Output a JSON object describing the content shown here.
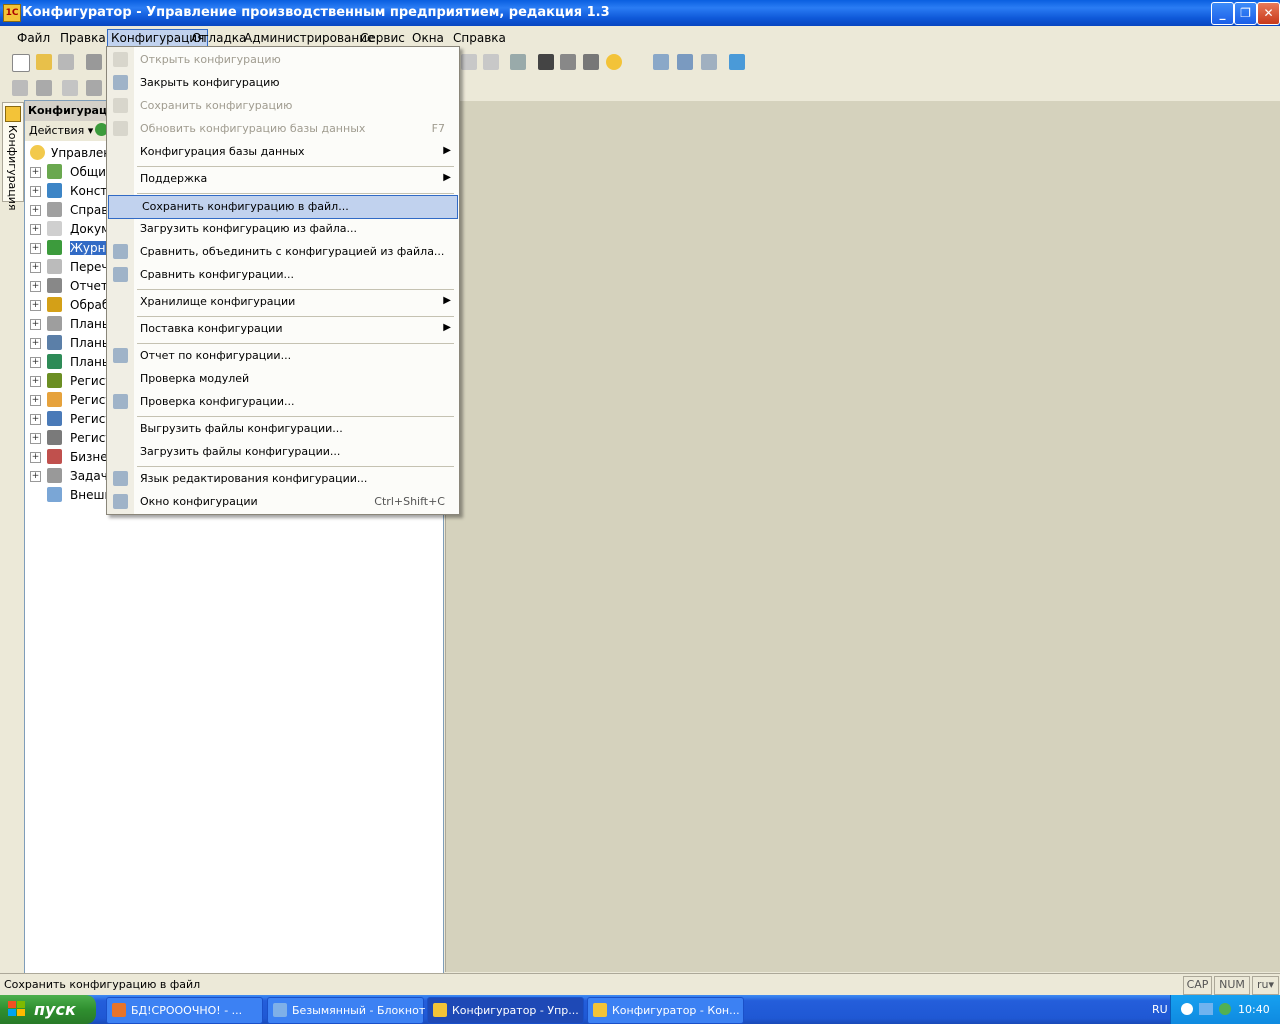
{
  "window": {
    "title": "Конфигуратор - Управление производственным предприятием, редакция 1.3",
    "min_label": "_",
    "max_label": "❐",
    "close_label": "✕"
  },
  "menubar": [
    "Файл",
    "Правка",
    "Конфигурация",
    "Отладка",
    "Администрирование",
    "Сервис",
    "Окна",
    "Справка"
  ],
  "side_tab_label": "Конфигурация",
  "panel": {
    "title": "Конфигураци",
    "actions_label": "Действия ▾",
    "tree": [
      {
        "label": "Управлени",
        "root": true,
        "icon_color": "#f2c94c"
      },
      {
        "label": "Общие",
        "icon_color": "#6aa84f"
      },
      {
        "label": "Конста",
        "icon_color": "#3d85c6"
      },
      {
        "label": "Справо",
        "icon_color": "#a0a0a0"
      },
      {
        "label": "Докум",
        "icon_color": "#cfcfcf"
      },
      {
        "label": "Журна",
        "selected": true,
        "icon_color": "#3c9b3c"
      },
      {
        "label": "Перечи",
        "icon_color": "#bbbbbb"
      },
      {
        "label": "Отчеты",
        "icon_color": "#888888"
      },
      {
        "label": "Обрабо",
        "icon_color": "#d4a017"
      },
      {
        "label": "Планы",
        "icon_color": "#9e9e9e"
      },
      {
        "label": "Планы",
        "icon_color": "#5b7fa8"
      },
      {
        "label": "Планы",
        "icon_color": "#2e8b57"
      },
      {
        "label": "Регист",
        "icon_color": "#6b8e23"
      },
      {
        "label": "Регист",
        "icon_color": "#e6a23c"
      },
      {
        "label": "Регист",
        "icon_color": "#4a7ab8"
      },
      {
        "label": "Регист",
        "icon_color": "#7a7a7a"
      },
      {
        "label": "Бизнес",
        "icon_color": "#c0504d"
      },
      {
        "label": "Задачи",
        "icon_color": "#999999"
      },
      {
        "label": "Внешни",
        "noexpand": true,
        "icon_color": "#7aa6d6"
      }
    ]
  },
  "dropdown": [
    {
      "label": "Открыть конфигурацию",
      "disabled": true,
      "icon": true
    },
    {
      "label": "Закрыть конфигурацию",
      "icon": true
    },
    {
      "label": "Сохранить конфигурацию",
      "disabled": true,
      "icon": true
    },
    {
      "label": "Обновить конфигурацию базы данных",
      "disabled": true,
      "shortcut": "F7",
      "icon": true
    },
    {
      "label": "Конфигурация базы данных",
      "submenu": true
    },
    {
      "sep": true
    },
    {
      "label": "Поддержка",
      "submenu": true
    },
    {
      "sep": true
    },
    {
      "label": "Сохранить конфигурацию в файл...",
      "highlighted": true
    },
    {
      "label": "Загрузить конфигурацию из файла..."
    },
    {
      "label": "Сравнить, объединить с конфигурацией из файла...",
      "icon": true
    },
    {
      "label": "Сравнить конфигурации...",
      "icon": true
    },
    {
      "sep": true
    },
    {
      "label": "Хранилище конфигурации",
      "submenu": true
    },
    {
      "sep": true
    },
    {
      "label": "Поставка конфигурации",
      "submenu": true
    },
    {
      "sep": true
    },
    {
      "label": "Отчет по конфигурации...",
      "icon": true
    },
    {
      "label": "Проверка модулей"
    },
    {
      "label": "Проверка конфигурации...",
      "icon": true
    },
    {
      "sep": true
    },
    {
      "label": "Выгрузить файлы конфигурации..."
    },
    {
      "label": "Загрузить файлы конфигурации..."
    },
    {
      "sep": true
    },
    {
      "label": "Язык редактирования конфигурации...",
      "icon": true
    },
    {
      "label": "Окно конфигурации",
      "shortcut": "Ctrl+Shift+C",
      "icon": true
    }
  ],
  "statusbar": {
    "text": "Сохранить конфигурацию в файл",
    "cap": "CAP",
    "num": "NUM",
    "lang": "ru▾"
  },
  "taskbar": {
    "start_label": "пуск",
    "tasks": [
      {
        "label": "БД!СРОООЧНО! - ...",
        "icon_color": "#e8742a"
      },
      {
        "label": "Безымянный - Блокнот",
        "icon_color": "#7fb0e8"
      },
      {
        "label": "Конфигуратор - Упр...",
        "active": true,
        "icon_color": "#f3c338"
      },
      {
        "label": "Конфигуратор - Кон...",
        "icon_color": "#f3c338"
      }
    ],
    "lang": "RU",
    "clock": "10:40"
  }
}
